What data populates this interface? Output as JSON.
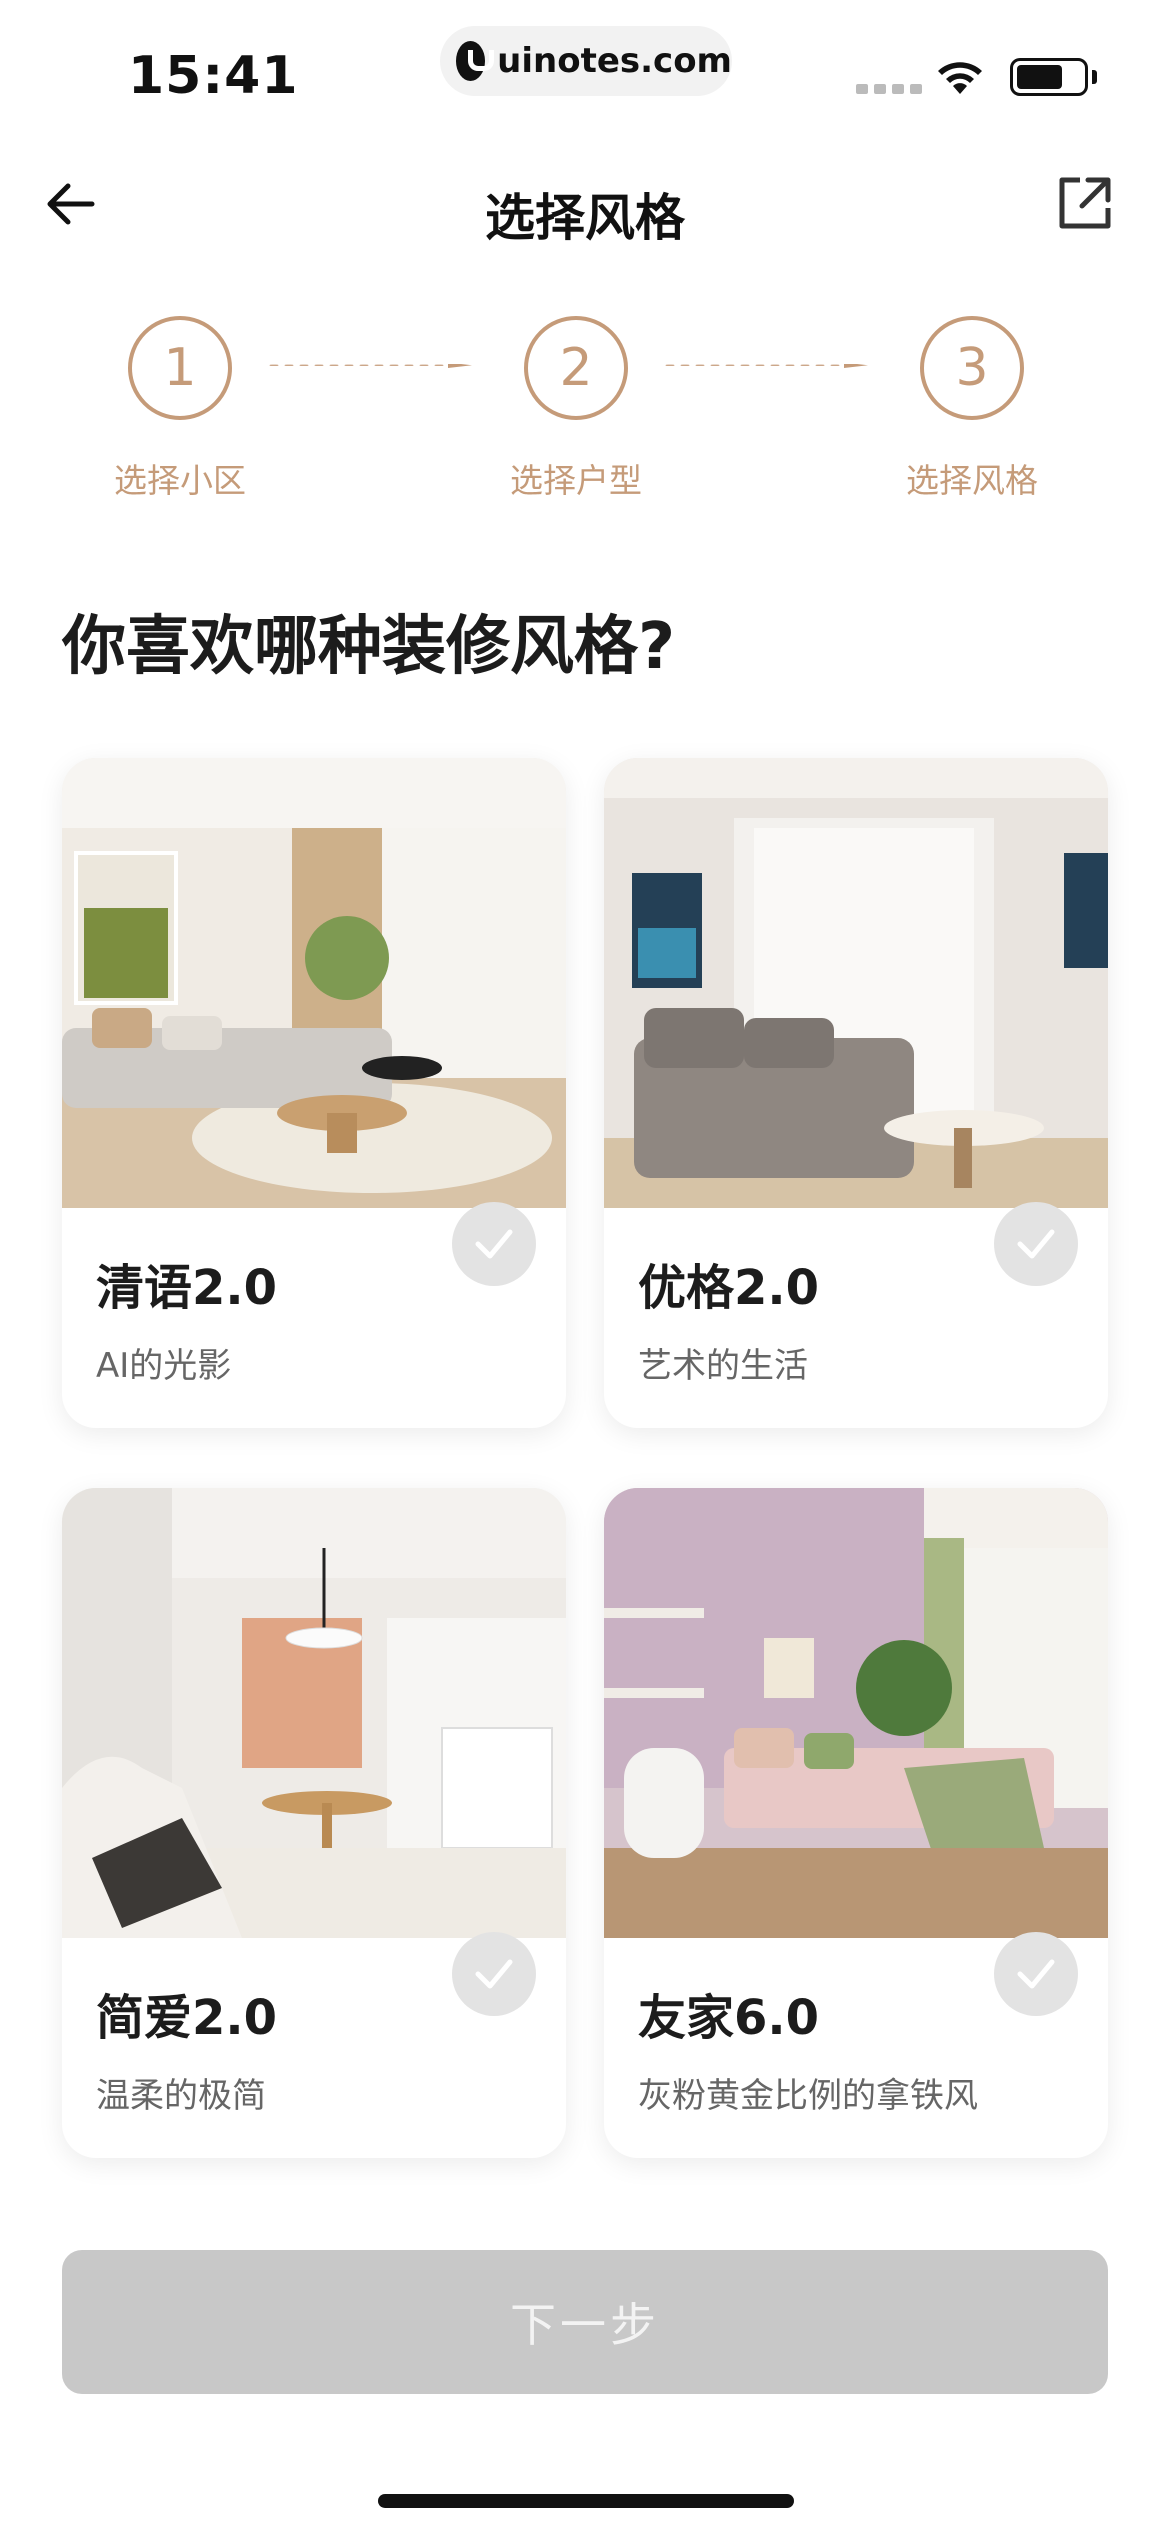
{
  "status_bar": {
    "time": "15:41",
    "url": "uinotes.com"
  },
  "nav": {
    "title": "选择风格",
    "back_icon": "arrow-left-icon",
    "share_icon": "external-link-icon"
  },
  "steps": [
    {
      "number": "1",
      "label": "选择小区"
    },
    {
      "number": "2",
      "label": "选择户型"
    },
    {
      "number": "3",
      "label": "选择风格"
    }
  ],
  "question": "你喜欢哪种装修风格?",
  "styles": [
    {
      "title": "清语2.0",
      "subtitle": "AI的光影"
    },
    {
      "title": "优格2.0",
      "subtitle": "艺术的生活"
    },
    {
      "title": "简爱2.0",
      "subtitle": "温柔的极简"
    },
    {
      "title": "友家6.0",
      "subtitle": "灰粉黄金比例的拿铁风"
    }
  ],
  "next_button": "下一步",
  "colors": {
    "accent": "#c59b79",
    "button_disabled": "#c8c8c8"
  }
}
